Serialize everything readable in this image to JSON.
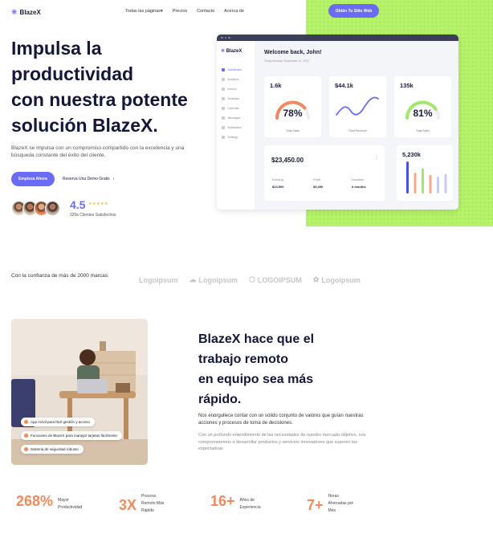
{
  "brand": {
    "name": "BlazeX",
    "accent": "#6a6cf6",
    "green": "#b6f36a",
    "orange": "#f08a5d"
  },
  "nav": {
    "items": [
      "Todas las páginas",
      "Precios",
      "Contacto",
      "Acerca de"
    ],
    "cta": "Obtén Tu Sitio Web"
  },
  "hero": {
    "title_lines": [
      "Impulsa la",
      "productividad",
      "con nuestra potente",
      "solución BlazeX."
    ],
    "desc_lines": [
      "BlazeX se impulsa con un compromiso compartido con la excelencia y una",
      "búsqueda constante del éxito del cliente."
    ],
    "primary_button": "Empieza Ahora",
    "secondary_button": "Reserva Una Demo Gratis",
    "rating": "4.5",
    "stars": "★★★★★",
    "clients": "325k Clientes Satisfechos"
  },
  "dashboard": {
    "logo": "BlazeX",
    "sidebar": [
      "Dashboard",
      "Analytics",
      "Invoice",
      "Schedule",
      "Calendar",
      "Messages",
      "Notification",
      "Settings"
    ],
    "welcome": "Welcome back, John!",
    "date": "Today Monday, September 11, 2022",
    "cards": [
      {
        "value": "1.6k",
        "percent": "78%",
        "label": "Total Sales",
        "progress": 0.78,
        "color": "#f08a5d"
      },
      {
        "value": "$44.1k",
        "label": "Total Revenue",
        "color": "#6a6cf6"
      },
      {
        "value": "135k",
        "percent": "81%",
        "label": "Total Sales",
        "progress": 0.81,
        "color": "#a3e86a"
      }
    ],
    "summary": {
      "value": "$23,450.00",
      "items": [
        {
          "key": "Earning",
          "value": "$24,560"
        },
        {
          "key": "Profit",
          "value": "$3,450"
        },
        {
          "key": "Duration",
          "value": "6 months"
        }
      ]
    },
    "bars_card": {
      "value": "5,230k",
      "bars": [
        {
          "value": 0.95,
          "color": "#4a4fe0"
        },
        {
          "value": 0.62,
          "color": "#f5a88a"
        },
        {
          "value": 0.75,
          "color": "#a3e86a"
        },
        {
          "value": 0.55,
          "color": "#f5a88a"
        },
        {
          "value": 0.5,
          "color": "#c9cbf4"
        },
        {
          "value": 0.58,
          "color": "#c9cbf4"
        }
      ]
    }
  },
  "trusted": {
    "text": "Con la confianza de más de 2000 marcas:",
    "logos": [
      "Logoipsum",
      "Logoipsum",
      "LOGOIPSUM",
      "Logoipsum"
    ]
  },
  "remote": {
    "title_lines": [
      "BlazeX hace que el",
      "trabajo remoto",
      "en equipo sea más",
      "rápido."
    ],
    "p1": "Nos enorgullece contar con un sólido conjunto de valores que guían nuestras acciones y procesos de toma de decisiones.",
    "p2": "Con un profundo entendimiento de las necesidades de nuestro mercado objetivo, nos comprometemos a desarrollar productos y servicios innovadores que superen las expectativas.",
    "features": [
      "App móvil para fácil gestión y acceso",
      "Funciones de BlazeX para manejar tarjetas fácilmente",
      "Sistema de seguridad robusto"
    ]
  },
  "stats": [
    {
      "num": "268%",
      "label_lines": [
        "Mayor",
        "Productividad"
      ]
    },
    {
      "num": "3X",
      "label_lines": [
        "Proceso",
        "Remoto Más",
        "Rápido"
      ]
    },
    {
      "num": "16+",
      "label_lines": [
        "Años de",
        "Experiencia"
      ]
    },
    {
      "num": "7+",
      "label_lines": [
        "Horas",
        "Ahorradas por",
        "Mes"
      ]
    }
  ]
}
